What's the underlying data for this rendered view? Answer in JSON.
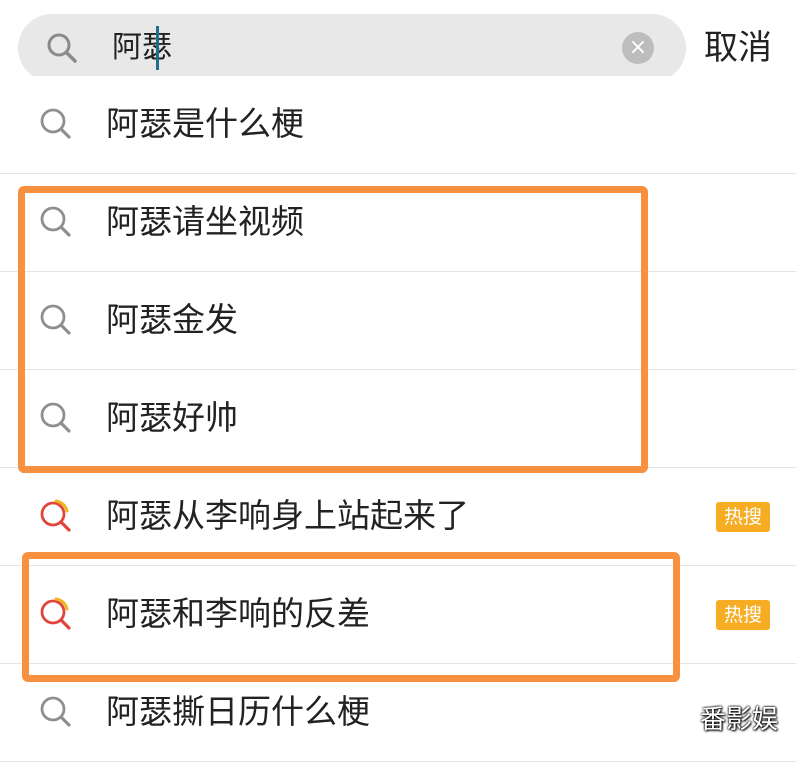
{
  "search": {
    "value": "阿瑟",
    "cancel_label": "取消",
    "clear_symbol": "×"
  },
  "colors": {
    "accent_highlight": "#f7913f",
    "hot_badge": "#f6ac23",
    "caret": "#1f6f8b"
  },
  "suggestions": [
    {
      "text": "阿瑟是什么梗",
      "icon": "search-icon",
      "badge": ""
    },
    {
      "text": "阿瑟请坐视频",
      "icon": "search-icon",
      "badge": ""
    },
    {
      "text": "阿瑟金发",
      "icon": "search-icon",
      "badge": ""
    },
    {
      "text": "阿瑟好帅",
      "icon": "search-icon",
      "badge": ""
    },
    {
      "text": "阿瑟从李响身上站起来了",
      "icon": "hot-search-icon",
      "badge": "热搜"
    },
    {
      "text": "阿瑟和李响的反差",
      "icon": "hot-search-icon",
      "badge": "热搜"
    },
    {
      "text": "阿瑟撕日历什么梗",
      "icon": "search-icon",
      "badge": ""
    }
  ],
  "watermark": "番影娱"
}
